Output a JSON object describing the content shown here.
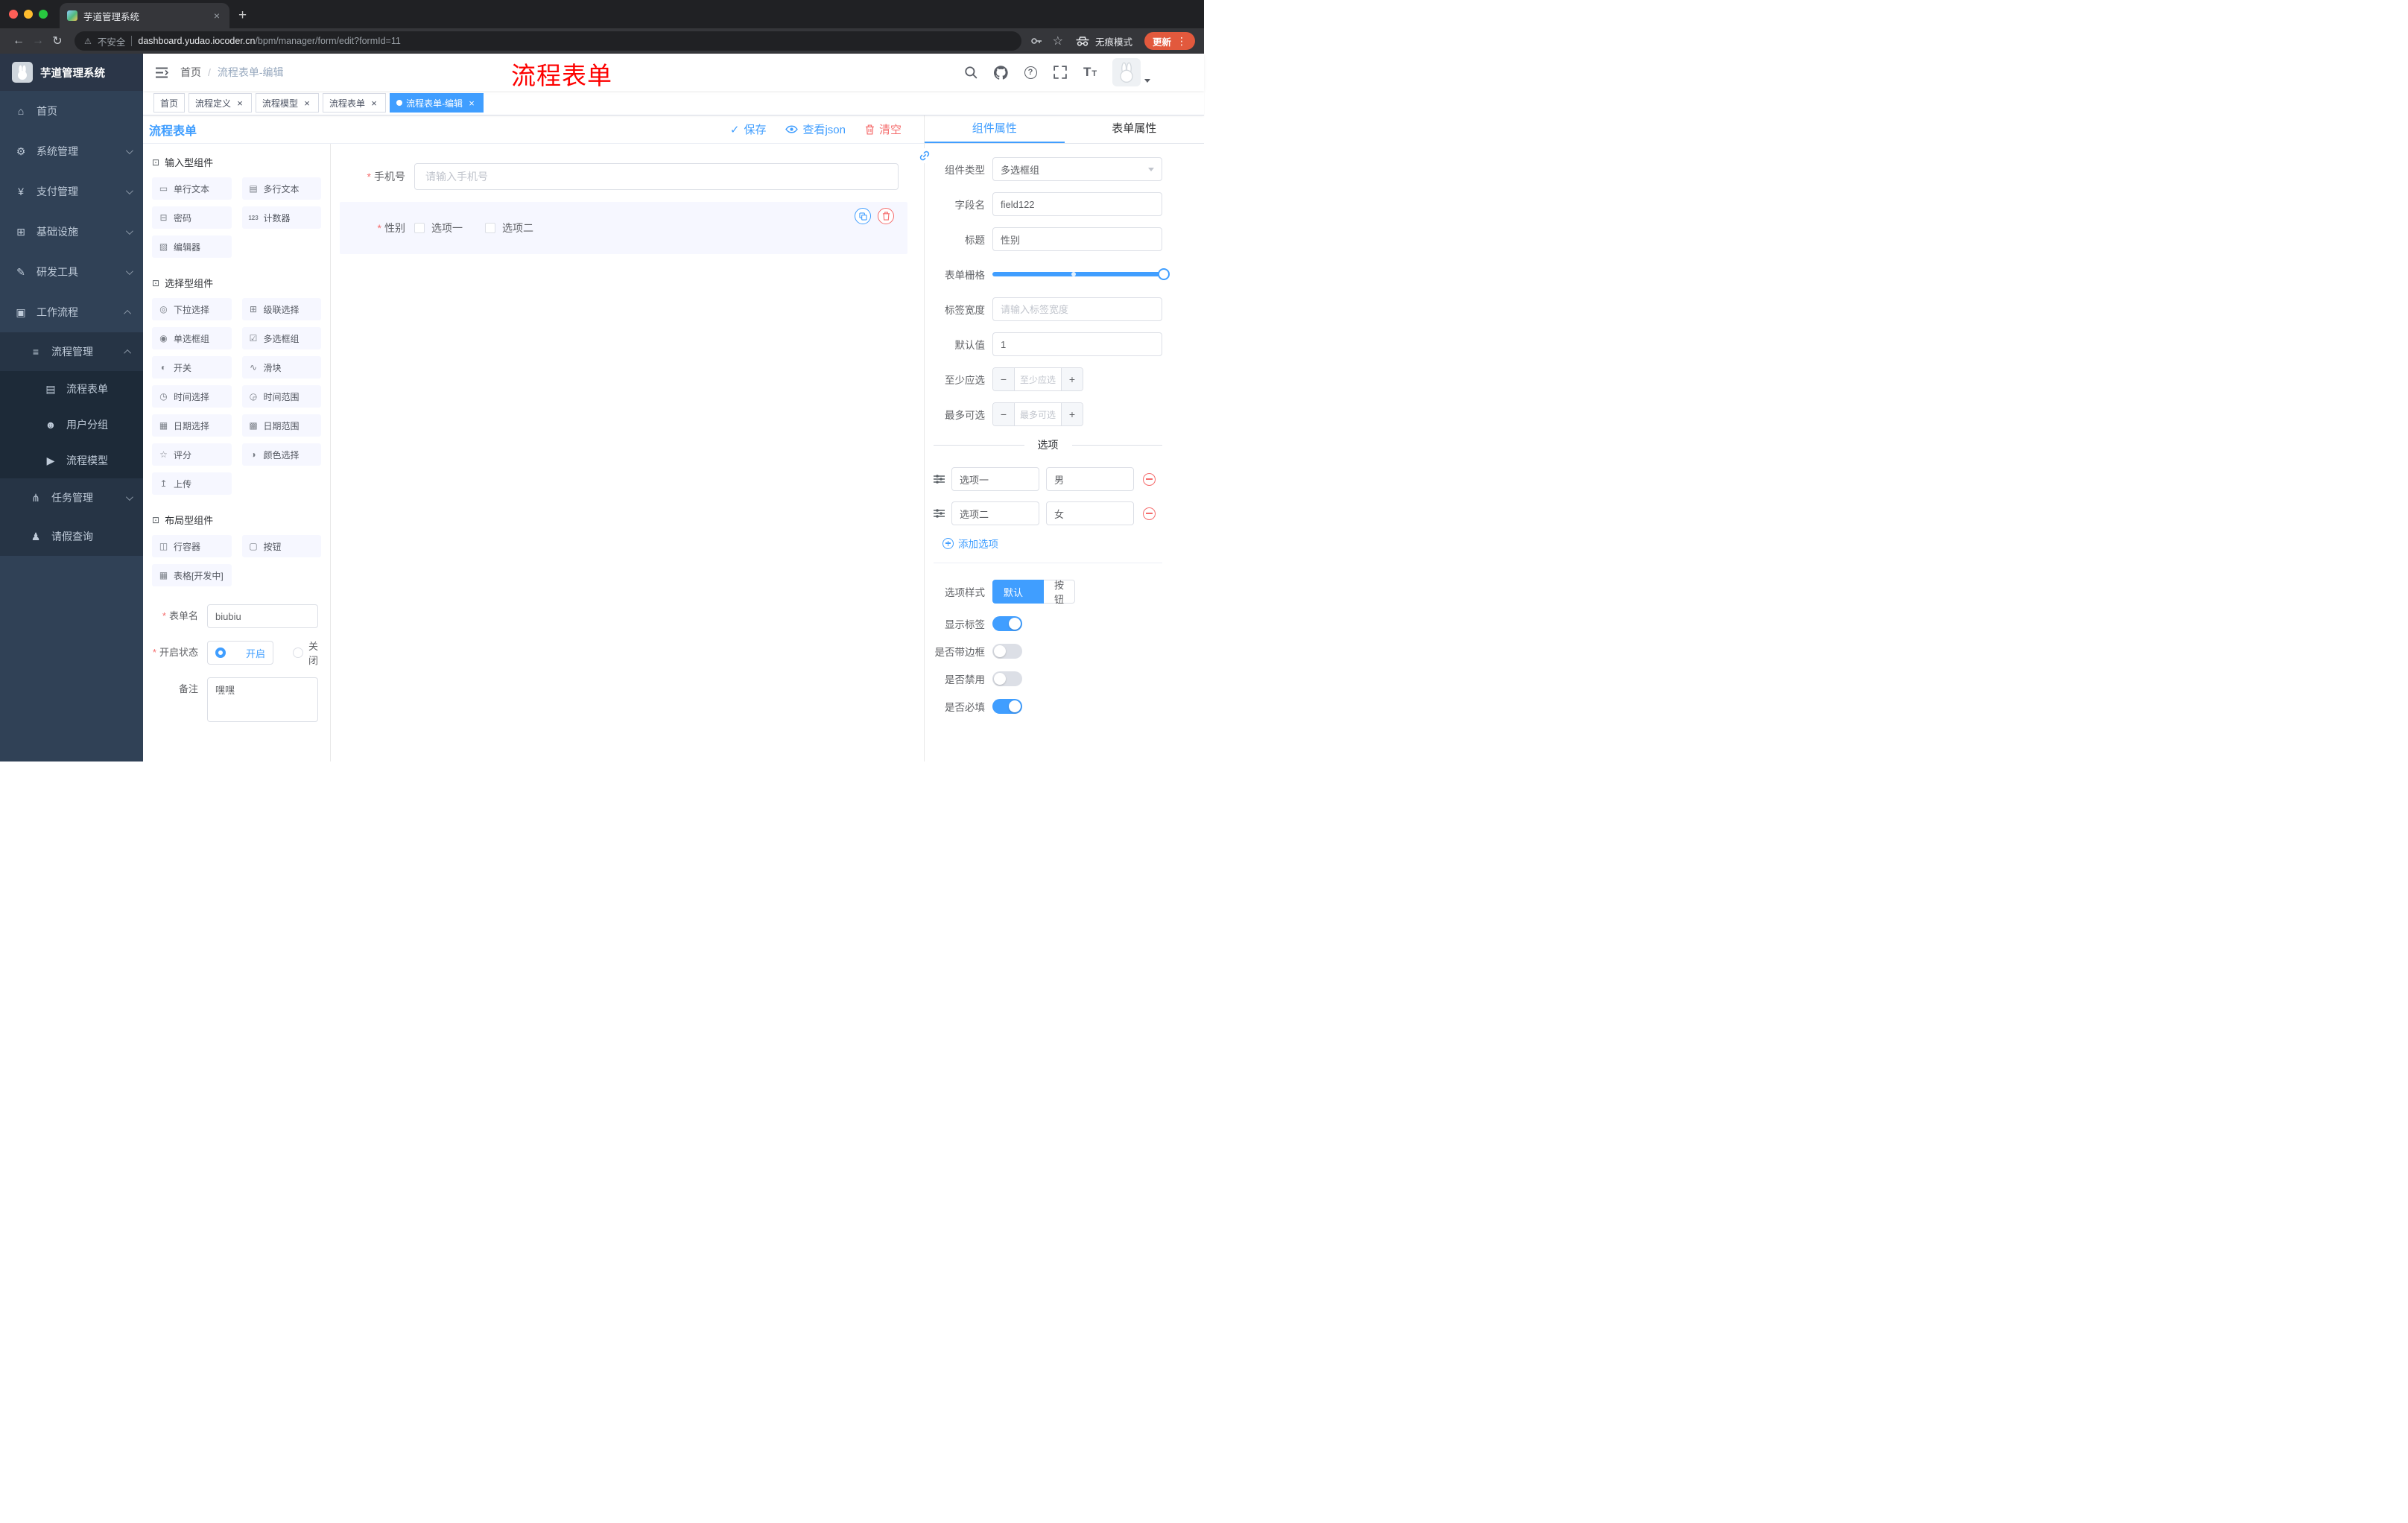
{
  "colors": {
    "primary": "#409eff",
    "danger": "#f56c6c",
    "annotation_red": "#fd0100",
    "sidebar_bg": "#304156",
    "tag_active_bg": "#409eff"
  },
  "browser": {
    "tab_title": "芋道管理系统",
    "security_label": "不安全",
    "url_host": "dashboard.yudao.iocoder.cn",
    "url_path": "/bpm/manager/form/edit?formId=11",
    "incognito_label": "无痕模式",
    "update_label": "更新"
  },
  "sidebar": {
    "logo_title": "芋道管理系统",
    "items": [
      {
        "label": "首页",
        "icon": "⌂"
      },
      {
        "label": "系统管理",
        "icon": "⚙"
      },
      {
        "label": "支付管理",
        "icon": "¥"
      },
      {
        "label": "基础设施",
        "icon": "⊞"
      },
      {
        "label": "研发工具",
        "icon": "✎"
      },
      {
        "label": "工作流程",
        "icon": "▣"
      },
      {
        "label": "流程管理",
        "icon": "≡"
      },
      {
        "label": "流程表单",
        "icon": "▤"
      },
      {
        "label": "用户分组",
        "icon": "☻"
      },
      {
        "label": "流程模型",
        "icon": "▶"
      },
      {
        "label": "任务管理",
        "icon": "⋔"
      },
      {
        "label": "请假查询",
        "icon": "♟"
      }
    ]
  },
  "navbar": {
    "breadcrumb_home": "首页",
    "breadcrumb_current": "流程表单-编辑",
    "annotation": "流程表单"
  },
  "tags": [
    {
      "label": "首页"
    },
    {
      "label": "流程定义"
    },
    {
      "label": "流程模型"
    },
    {
      "label": "流程表单"
    },
    {
      "label": "流程表单-编辑"
    }
  ],
  "designer": {
    "panel_title": "流程表单",
    "actions": {
      "save": "保存",
      "view_json": "查看json",
      "clear": "清空"
    },
    "palette": {
      "sections": [
        {
          "title": "输入型组件",
          "items": [
            {
              "label": "单行文本",
              "icon": "▭"
            },
            {
              "label": "多行文本",
              "icon": "▤"
            },
            {
              "label": "密码",
              "icon": "⊟"
            },
            {
              "label": "计数器",
              "icon": "123"
            },
            {
              "label": "编辑器",
              "icon": "▧"
            }
          ]
        },
        {
          "title": "选择型组件",
          "items": [
            {
              "label": "下拉选择",
              "icon": "◎"
            },
            {
              "label": "级联选择",
              "icon": "⊞"
            },
            {
              "label": "单选框组",
              "icon": "◉"
            },
            {
              "label": "多选框组",
              "icon": "☑"
            },
            {
              "label": "开关",
              "icon": "◐"
            },
            {
              "label": "滑块",
              "icon": "∿"
            },
            {
              "label": "时间选择",
              "icon": "◷"
            },
            {
              "label": "时间范围",
              "icon": "◶"
            },
            {
              "label": "日期选择",
              "icon": "▦"
            },
            {
              "label": "日期范围",
              "icon": "▩"
            },
            {
              "label": "评分",
              "icon": "☆"
            },
            {
              "label": "颜色选择",
              "icon": "◑"
            },
            {
              "label": "上传",
              "icon": "↥"
            }
          ]
        },
        {
          "title": "布局型组件",
          "items": [
            {
              "label": "行容器",
              "icon": "◫"
            },
            {
              "label": "按钮",
              "icon": "▢"
            },
            {
              "label": "表格[开发中]",
              "icon": "▦"
            }
          ]
        }
      ]
    },
    "meta": {
      "name_label": "表单名",
      "name_value": "biubiu",
      "status_label": "开启状态",
      "status_on": "开启",
      "status_off": "关闭",
      "remark_label": "备注",
      "remark_value": "嘿嘿"
    },
    "canvas": {
      "phone_label": "手机号",
      "phone_placeholder": "请输入手机号",
      "gender_label": "性别",
      "gender_option1": "选项一",
      "gender_option2": "选项二"
    }
  },
  "inspector": {
    "tab_component": "组件属性",
    "tab_form": "表单属性",
    "component_type_label": "组件类型",
    "component_type_value": "多选框组",
    "field_name_label": "字段名",
    "field_name_value": "field122",
    "title_label": "标题",
    "title_value": "性别",
    "grid_label": "表单栅格",
    "label_width_label": "标签宽度",
    "label_width_placeholder": "请输入标签宽度",
    "default_label": "默认值",
    "default_value": "1",
    "min_label": "至少应选",
    "min_placeholder": "至少应选",
    "max_label": "最多可选",
    "max_placeholder": "最多可选",
    "options_title": "选项",
    "options": [
      {
        "label": "选项一",
        "value": "男"
      },
      {
        "label": "选项二",
        "value": "女"
      }
    ],
    "add_option_label": "添加选项",
    "style_label": "选项样式",
    "style_default": "默认",
    "style_button": "按钮",
    "switches": [
      {
        "label": "显示标签",
        "on": true
      },
      {
        "label": "是否带边框",
        "on": false
      },
      {
        "label": "是否禁用",
        "on": false
      },
      {
        "label": "是否必填",
        "on": true
      }
    ]
  }
}
